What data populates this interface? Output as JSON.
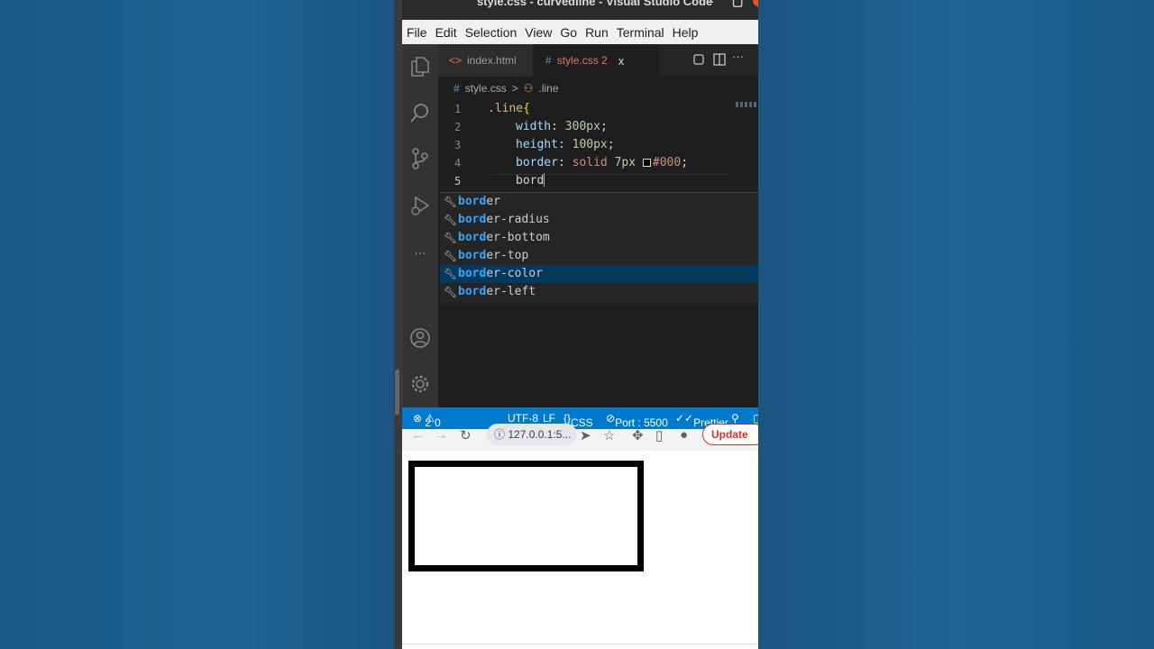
{
  "window": {
    "title": "style.css - curvedline - Visual Studio Code",
    "minimize": "–",
    "maximize": "▢"
  },
  "menu": [
    "File",
    "Edit",
    "Selection",
    "View",
    "Go",
    "Run",
    "Terminal",
    "Help"
  ],
  "activity_icons": [
    "files-icon",
    "search-icon",
    "source-control-icon",
    "run-debug-icon",
    "more-icon",
    "account-icon",
    "settings-gear-icon"
  ],
  "tabs": [
    {
      "label": "index.html",
      "icon": "<>"
    },
    {
      "label": "style.css 2",
      "icon": "#",
      "close": "x",
      "active": true
    }
  ],
  "breadcrumb": {
    "file": "style.css",
    "separator": ">",
    "symbol": ".line"
  },
  "editor": {
    "lines": [
      {
        "num": "1",
        "selector": ".line",
        "brace": "{"
      },
      {
        "num": "2",
        "prop": "width",
        "value": "300px"
      },
      {
        "num": "3",
        "prop": "height",
        "value": "100px"
      },
      {
        "num": "4",
        "prop": "border",
        "kw": "solid",
        "value": "7px",
        "color": "#000"
      },
      {
        "num": "5",
        "typed": "bord"
      }
    ]
  },
  "suggestions": [
    {
      "match": "bord",
      "rest": "er"
    },
    {
      "match": "bord",
      "rest": "er-radius"
    },
    {
      "match": "bord",
      "rest": "er-bottom"
    },
    {
      "match": "bord",
      "rest": "er-top"
    },
    {
      "match": "bord",
      "rest": "er-color",
      "active": true
    },
    {
      "match": "bord",
      "rest": "er-left"
    }
  ],
  "status": {
    "errors": "2",
    "warnings": "0",
    "encoding": "UTF-8",
    "eol": "LF",
    "language": "CSS",
    "port": "Port : 5500",
    "prettier": "Prettier"
  },
  "browser": {
    "url": "127.0.0.1:5...",
    "update_label": "Update"
  },
  "preview": {
    "border_color": "#000000",
    "background": "#ffffff"
  },
  "colors": {
    "accent": "#007acc",
    "active_tab_text": "#e5735f",
    "suggest_match": "#2aaaff"
  }
}
